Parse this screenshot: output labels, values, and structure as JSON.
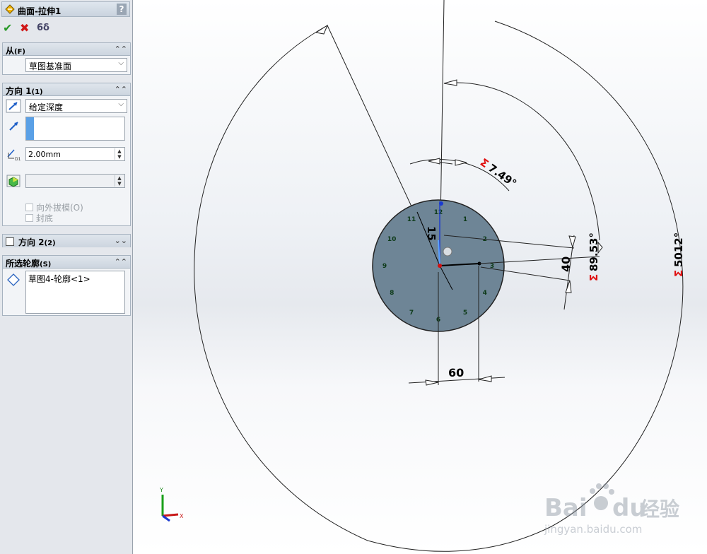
{
  "panel": {
    "title": "曲面-拉伸1",
    "help": "?",
    "actions": {
      "ok": "✔",
      "cancel": "✖",
      "preview": "6δ"
    },
    "from_group": {
      "title": "从",
      "shortcut": "(F)",
      "value": "草图基准面"
    },
    "dir1_group": {
      "title": "方向 1",
      "shortcut": "(1)",
      "end_condition": "给定深度",
      "depth": "2.00mm",
      "draft_outward": "向外拔模(O)",
      "cap_end": "封底"
    },
    "dir2_group": {
      "title": "方向 2",
      "shortcut": "(2)"
    },
    "contours_group": {
      "title": "所选轮廓",
      "shortcut": "(S)",
      "item": "草图4-轮廓<1>"
    }
  },
  "viewport": {
    "dims": {
      "angle_small": "7.49°",
      "angle_89": "89.53°",
      "angle_5012": "5012°",
      "d15": "15",
      "d40": "40",
      "d60": "60",
      "sigma": "Σ"
    },
    "clock_numbers": [
      "1",
      "2",
      "3",
      "4",
      "5",
      "6",
      "7",
      "8",
      "9",
      "10",
      "11",
      "12"
    ],
    "triad": {
      "y": "Y",
      "x": "X"
    },
    "watermark": {
      "brand": "Bai",
      "brand2": "du",
      "jingyan": "经验",
      "url": "jingyan.baidu.com"
    }
  }
}
